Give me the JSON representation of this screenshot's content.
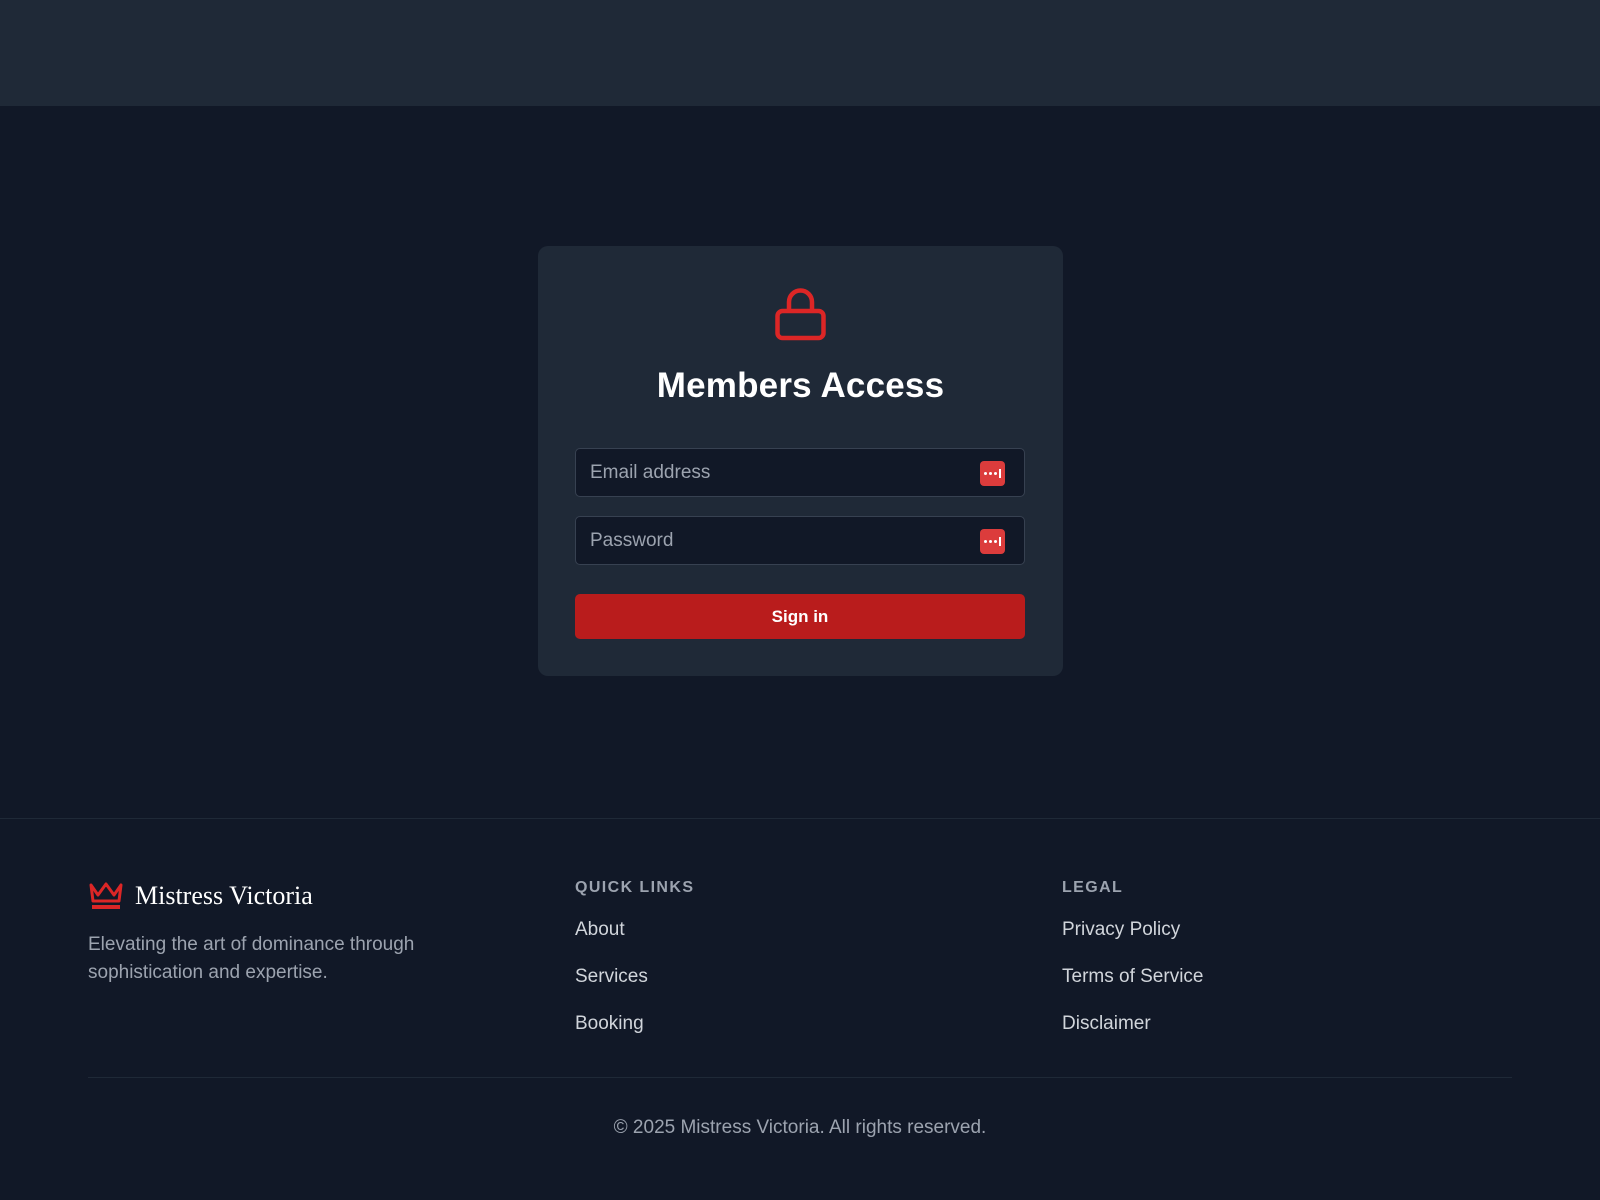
{
  "login": {
    "title": "Members Access",
    "email_placeholder": "Email address",
    "password_placeholder": "Password",
    "submit_label": "Sign in",
    "icon": "lock-icon"
  },
  "footer": {
    "brand_name": "Mistress Victoria",
    "brand_icon": "crown-icon",
    "tagline": "Elevating the art of dominance through sophistication and expertise.",
    "quick_links": {
      "heading": "QUICK LINKS",
      "items": [
        "About",
        "Services",
        "Booking"
      ]
    },
    "legal": {
      "heading": "LEGAL",
      "items": [
        "Privacy Policy",
        "Terms of Service",
        "Disclaimer"
      ]
    },
    "copyright": "© 2025 Mistress Victoria. All rights reserved."
  },
  "colors": {
    "accent": "#dc2626",
    "button": "#b91c1c",
    "background": "#111827",
    "card": "#1f2937"
  }
}
